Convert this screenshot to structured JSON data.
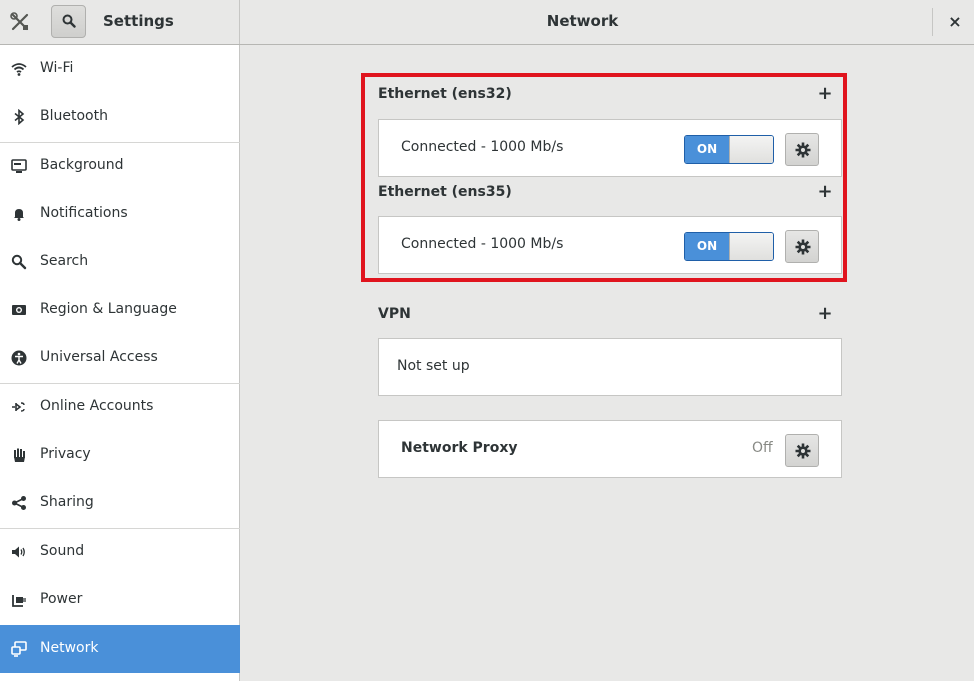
{
  "header": {
    "app_title": "Settings",
    "page_title": "Network",
    "close_glyph": "×"
  },
  "sidebar": {
    "items": [
      {
        "label": "Wi-Fi",
        "icon": "wifi-icon"
      },
      {
        "label": "Bluetooth",
        "icon": "bluetooth-icon"
      },
      {
        "label": "Background",
        "icon": "background-icon"
      },
      {
        "label": "Notifications",
        "icon": "bell-icon"
      },
      {
        "label": "Search",
        "icon": "search-icon"
      },
      {
        "label": "Region & Language",
        "icon": "camera-icon"
      },
      {
        "label": "Universal Access",
        "icon": "accessibility-icon"
      },
      {
        "label": "Online Accounts",
        "icon": "online-accounts-icon"
      },
      {
        "label": "Privacy",
        "icon": "hand-icon"
      },
      {
        "label": "Sharing",
        "icon": "share-icon"
      },
      {
        "label": "Sound",
        "icon": "speaker-icon"
      },
      {
        "label": "Power",
        "icon": "power-icon"
      },
      {
        "label": "Network",
        "icon": "network-icon",
        "active": true
      }
    ]
  },
  "network": {
    "ethernet": [
      {
        "name": "Ethernet (ens32)",
        "status": "Connected - 1000 Mb/s",
        "switch": "ON"
      },
      {
        "name": "Ethernet (ens35)",
        "status": "Connected - 1000 Mb/s",
        "switch": "ON"
      }
    ],
    "vpn": {
      "name": "VPN",
      "status": "Not set up"
    },
    "proxy": {
      "label": "Network Proxy",
      "state": "Off"
    },
    "add_glyph": "+"
  },
  "colors": {
    "accent": "#4a90d9",
    "highlight": "#e0141e",
    "background": "#e8e8e7"
  }
}
